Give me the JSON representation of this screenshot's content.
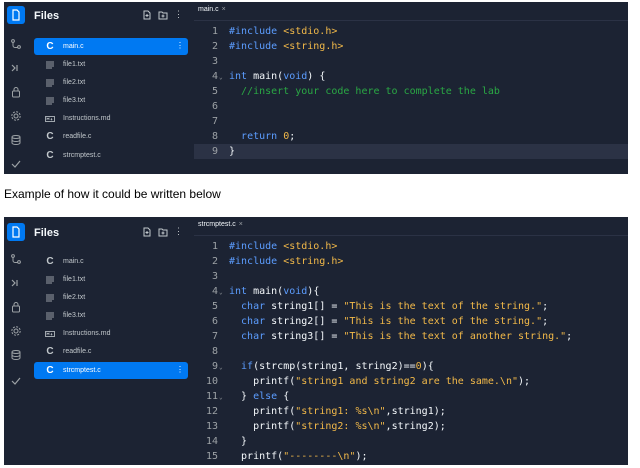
{
  "caption": "Example of how it could be written below",
  "panels": [
    {
      "sidebar": {
        "title": "Files",
        "files": [
          {
            "name": "main.c",
            "type": "c",
            "selected": true
          },
          {
            "name": "file1.txt",
            "type": "txt",
            "selected": false
          },
          {
            "name": "file2.txt",
            "type": "txt",
            "selected": false
          },
          {
            "name": "file3.txt",
            "type": "txt",
            "selected": false
          },
          {
            "name": "Instructions.md",
            "type": "md",
            "selected": false
          },
          {
            "name": "readfile.c",
            "type": "c",
            "selected": false
          },
          {
            "name": "strcmptest.c",
            "type": "c",
            "selected": false
          }
        ]
      },
      "editor": {
        "tab": "main.c",
        "active_line": 9,
        "lines": [
          {
            "n": "1",
            "fold": false,
            "segs": [
              {
                "t": "#include ",
                "c": "kw"
              },
              {
                "t": "<stdio.h>",
                "c": "str"
              }
            ]
          },
          {
            "n": "2",
            "fold": false,
            "segs": [
              {
                "t": "#include ",
                "c": "kw"
              },
              {
                "t": "<string.h>",
                "c": "str"
              }
            ]
          },
          {
            "n": "3",
            "fold": false,
            "segs": []
          },
          {
            "n": "4",
            "fold": true,
            "segs": [
              {
                "t": "int ",
                "c": "kw"
              },
              {
                "t": "main(",
                "c": ""
              },
              {
                "t": "void",
                "c": "kw"
              },
              {
                "t": ") {",
                "c": ""
              }
            ]
          },
          {
            "n": "5",
            "fold": false,
            "segs": [
              {
                "t": "  //insert your code here to complete the lab",
                "c": "cmt"
              }
            ]
          },
          {
            "n": "6",
            "fold": false,
            "segs": []
          },
          {
            "n": "7",
            "fold": false,
            "segs": []
          },
          {
            "n": "8",
            "fold": false,
            "segs": [
              {
                "t": "  ",
                "c": ""
              },
              {
                "t": "return ",
                "c": "kw"
              },
              {
                "t": "0",
                "c": "num"
              },
              {
                "t": ";",
                "c": ""
              }
            ]
          },
          {
            "n": "9",
            "fold": false,
            "segs": [
              {
                "t": "}",
                "c": ""
              }
            ]
          }
        ]
      }
    },
    {
      "sidebar": {
        "title": "Files",
        "files": [
          {
            "name": "main.c",
            "type": "c",
            "selected": false
          },
          {
            "name": "file1.txt",
            "type": "txt",
            "selected": false
          },
          {
            "name": "file2.txt",
            "type": "txt",
            "selected": false
          },
          {
            "name": "file3.txt",
            "type": "txt",
            "selected": false
          },
          {
            "name": "Instructions.md",
            "type": "md",
            "selected": false
          },
          {
            "name": "readfile.c",
            "type": "c",
            "selected": false
          },
          {
            "name": "strcmptest.c",
            "type": "c",
            "selected": true
          }
        ]
      },
      "editor": {
        "tab": "strcmptest.c",
        "active_line": 0,
        "lines": [
          {
            "n": "1",
            "fold": false,
            "segs": [
              {
                "t": "#include ",
                "c": "kw"
              },
              {
                "t": "<stdio.h>",
                "c": "str"
              }
            ]
          },
          {
            "n": "2",
            "fold": false,
            "segs": [
              {
                "t": "#include ",
                "c": "kw"
              },
              {
                "t": "<string.h>",
                "c": "str"
              }
            ]
          },
          {
            "n": "3",
            "fold": false,
            "segs": []
          },
          {
            "n": "4",
            "fold": true,
            "segs": [
              {
                "t": "int ",
                "c": "kw"
              },
              {
                "t": "main(",
                "c": ""
              },
              {
                "t": "void",
                "c": "kw"
              },
              {
                "t": "){",
                "c": ""
              }
            ]
          },
          {
            "n": "5",
            "fold": false,
            "segs": [
              {
                "t": "  char ",
                "c": "kw"
              },
              {
                "t": "string1[] = ",
                "c": ""
              },
              {
                "t": "\"This is the text of the string.\"",
                "c": "str"
              },
              {
                "t": ";",
                "c": ""
              }
            ]
          },
          {
            "n": "6",
            "fold": false,
            "segs": [
              {
                "t": "  char ",
                "c": "kw"
              },
              {
                "t": "string2[] = ",
                "c": ""
              },
              {
                "t": "\"This is the text of the string.\"",
                "c": "str"
              },
              {
                "t": ";",
                "c": ""
              }
            ]
          },
          {
            "n": "7",
            "fold": false,
            "segs": [
              {
                "t": "  char ",
                "c": "kw"
              },
              {
                "t": "string3[] = ",
                "c": ""
              },
              {
                "t": "\"This is the text of another string.\"",
                "c": "str"
              },
              {
                "t": ";",
                "c": ""
              }
            ]
          },
          {
            "n": "8",
            "fold": false,
            "segs": []
          },
          {
            "n": "9",
            "fold": true,
            "segs": [
              {
                "t": "  if",
                "c": "kw"
              },
              {
                "t": "(strcmp(string1, string2)==",
                "c": ""
              },
              {
                "t": "0",
                "c": "num"
              },
              {
                "t": "){",
                "c": ""
              }
            ]
          },
          {
            "n": "10",
            "fold": false,
            "segs": [
              {
                "t": "    printf(",
                "c": ""
              },
              {
                "t": "\"string1 and string2 are the same.\\n\"",
                "c": "str"
              },
              {
                "t": ");",
                "c": ""
              }
            ]
          },
          {
            "n": "11",
            "fold": true,
            "segs": [
              {
                "t": "  } ",
                "c": ""
              },
              {
                "t": "else",
                "c": "kw"
              },
              {
                "t": " {",
                "c": ""
              }
            ]
          },
          {
            "n": "12",
            "fold": false,
            "segs": [
              {
                "t": "    printf(",
                "c": ""
              },
              {
                "t": "\"string1: %s\\n\"",
                "c": "str"
              },
              {
                "t": ",string1);",
                "c": ""
              }
            ]
          },
          {
            "n": "13",
            "fold": false,
            "segs": [
              {
                "t": "    printf(",
                "c": ""
              },
              {
                "t": "\"string2: %s\\n\"",
                "c": "str"
              },
              {
                "t": ",string2);",
                "c": ""
              }
            ]
          },
          {
            "n": "14",
            "fold": false,
            "segs": [
              {
                "t": "  }",
                "c": ""
              }
            ]
          },
          {
            "n": "15",
            "fold": false,
            "segs": [
              {
                "t": "  printf(",
                "c": ""
              },
              {
                "t": "\"--------\\n\"",
                "c": "str"
              },
              {
                "t": ");",
                "c": ""
              }
            ]
          }
        ]
      }
    }
  ],
  "rail_icons": [
    "files-icon",
    "version-control-icon",
    "run-console-icon",
    "secrets-lock-icon",
    "settings-gear-icon",
    "database-icon",
    "check-icon"
  ],
  "colors": {
    "background": "#1c2333",
    "accent": "#0079f2",
    "keyword": "#5c9dff",
    "string": "#f2b949",
    "comment": "#2aa844"
  }
}
